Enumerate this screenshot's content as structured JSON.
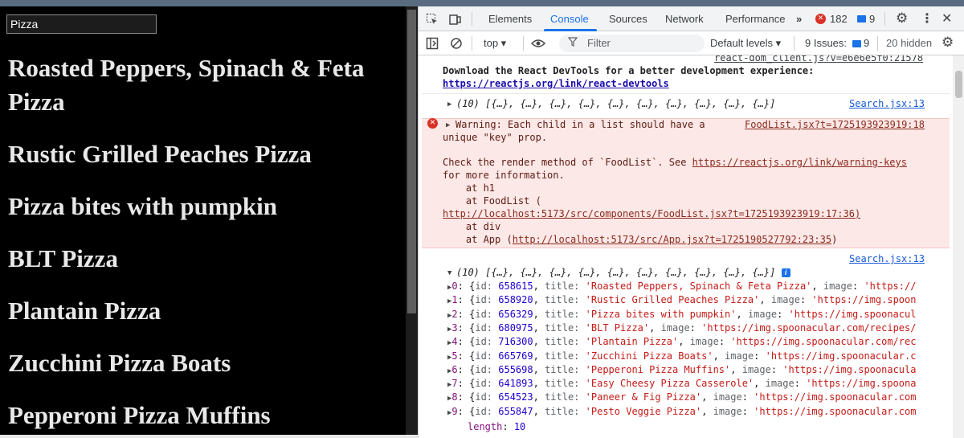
{
  "app": {
    "search_value": "Pizza",
    "foods": [
      "Roasted Peppers, Spinach & Feta Pizza",
      "Rustic Grilled Peaches Pizza",
      "Pizza bites with pumpkin",
      "BLT Pizza",
      "Plantain Pizza",
      "Zucchini Pizza Boats",
      "Pepperoni Pizza Muffins"
    ]
  },
  "devtools": {
    "tabs": [
      "Elements",
      "Console",
      "Sources",
      "Network",
      "Performance"
    ],
    "active_tab": "Console",
    "more_tabs": "»",
    "error_count": "182",
    "message_count": "9",
    "toolbar": {
      "context": "top ▾",
      "filter_placeholder": "Filter",
      "levels": "Default levels ▾",
      "issues_label": "9 Issues:",
      "issues_count": "9",
      "hidden": "20 hidden"
    },
    "console": {
      "top_link": "react-dom_client.js?v=e6e6e5f0:21578",
      "devtools_msg_1": "Download the React DevTools for a better development experience:",
      "devtools_msg_2": "https://reactjs.org/link/react-devtools",
      "log1_summary": "(10) [{…}, {…}, {…}, {…}, {…}, {…}, {…}, {…}, {…}, {…}]",
      "log1_source": "Search.jsx:13",
      "warning_line1": "Warning: Each child in a list should have a",
      "warning_source": "FoodList.jsx?t=1725193923919:18",
      "warning_line2": "unique \"key\" prop.",
      "warning_line3_pre": "Check the render method of `FoodList`. See ",
      "warning_line3_link": "https://reactjs.org/link/warning-keys",
      "warning_line4": "for more information.",
      "stack_1": "    at h1",
      "stack_2": "    at FoodList (",
      "stack_3": "http://localhost:5173/src/components/FoodList.jsx?t=1725193923919:17:36)",
      "stack_4": "    at div",
      "stack_5_pre": "    at App (",
      "stack_5_link": "http://localhost:5173/src/App.jsx?t=1725190527792:23:35",
      "stack_5_post": ")",
      "log2_source": "Search.jsx:13",
      "log2_summary": "(10) [{…}, {…}, {…}, {…}, {…}, {…}, {…}, {…}, {…}, {…}]",
      "entries": [
        {
          "idx": "0",
          "id": "658615",
          "title": "'Roasted Peppers, Spinach & Feta Pizza'",
          "tail": ", image: 'https://"
        },
        {
          "idx": "1",
          "id": "658920",
          "title": "'Rustic Grilled Peaches Pizza'",
          "tail": ", image: 'https://img.spoon"
        },
        {
          "idx": "2",
          "id": "656329",
          "title": "'Pizza bites with pumpkin'",
          "tail": ", image: 'https://img.spoonacul"
        },
        {
          "idx": "3",
          "id": "680975",
          "title": "'BLT Pizza'",
          "tail": ", image: 'https://img.spoonacular.com/recipes/"
        },
        {
          "idx": "4",
          "id": "716300",
          "title": "'Plantain Pizza'",
          "tail": ", image: 'https://img.spoonacular.com/rec"
        },
        {
          "idx": "5",
          "id": "665769",
          "title": "'Zucchini Pizza Boats'",
          "tail": ", image: 'https://img.spoonacular.c"
        },
        {
          "idx": "6",
          "id": "655698",
          "title": "'Pepperoni Pizza Muffins'",
          "tail": ", image: 'https://img.spoonacula"
        },
        {
          "idx": "7",
          "id": "641893",
          "title": "'Easy Cheesy Pizza Casserole'",
          "tail": ", image: 'https://img.spoona"
        },
        {
          "idx": "8",
          "id": "654523",
          "title": "'Paneer & Fig Pizza'",
          "tail": ", image: 'https://img.spoonacular.com"
        },
        {
          "idx": "9",
          "id": "655847",
          "title": "'Pesto Veggie Pizza'",
          "tail": ", image: 'https://img.spoonacular.com"
        }
      ],
      "length_label": "length",
      "length_value": "10"
    }
  }
}
